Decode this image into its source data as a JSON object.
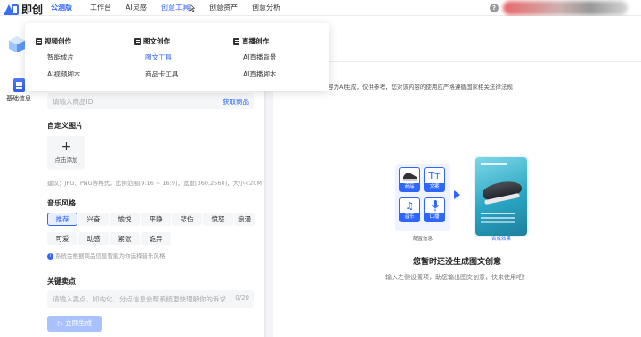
{
  "header": {
    "logo_text": "即创",
    "badge": "公测版",
    "nav": [
      "工作台",
      "AI灵感",
      "创意工具",
      "创意资产",
      "创意分析"
    ],
    "active_nav": "创意工具",
    "help_icon": "?"
  },
  "rail": {
    "item_label": "基础信息"
  },
  "dropdown": {
    "columns": [
      {
        "title": "视频创作",
        "items": [
          "智能成片",
          "AI视频脚本"
        ]
      },
      {
        "title": "图文创作",
        "items": [
          "图文工具",
          "商品卡工具"
        ]
      },
      {
        "title": "直播创作",
        "items": [
          "AI直播背景",
          "AI直播脚本"
        ]
      }
    ],
    "active_item": "图文工具"
  },
  "form": {
    "product_placeholder": "请输入商品ID",
    "product_link": "获取商品",
    "custom_image_title": "自定义图片",
    "upload_plus": "+",
    "upload_label": "点击添加",
    "upload_hint": "建议：JPG、PNG等格式，比例范围[9:16 ~ 16:9]，宽度[360,2560]，大小<20M",
    "music_title": "音乐风格",
    "music_styles": [
      "推荐",
      "兴奋",
      "愉悦",
      "平静",
      "悲伤",
      "愤怒",
      "浪漫",
      "可爱",
      "动感",
      "紧张",
      "诡异"
    ],
    "music_selected": "推荐",
    "music_hint": "系统会根据商品信息智能为你选择音乐风格",
    "info_icon": "i",
    "selling_title": "关键卖点",
    "selling_placeholder": "请输入卖点、如构化、分点信息会帮系统更快理解你的诉求",
    "selling_counter": "0/20",
    "generate_label": "立即生成"
  },
  "preview": {
    "notice": "容为AI生成，仅供参考，您对该内容的使用应严格遵循国家相关法律法规",
    "tiles": [
      {
        "label": "商品",
        "glyph": ""
      },
      {
        "label": "文案",
        "glyph": "Tт"
      },
      {
        "label": "音乐",
        "glyph": "♫"
      },
      {
        "label": "口播",
        "glyph": "🎙"
      }
    ],
    "left_caption": "配置信息",
    "right_caption": "合成效果",
    "empty_title": "您暂时还没生成图文创意",
    "empty_sub": "输入左侧设置项，助您输出图文创意，快来使用吧！"
  },
  "colors": {
    "accent": "#2e66ff",
    "accent_light": "#e8efff",
    "button_disabled": "#a9c2ff"
  }
}
